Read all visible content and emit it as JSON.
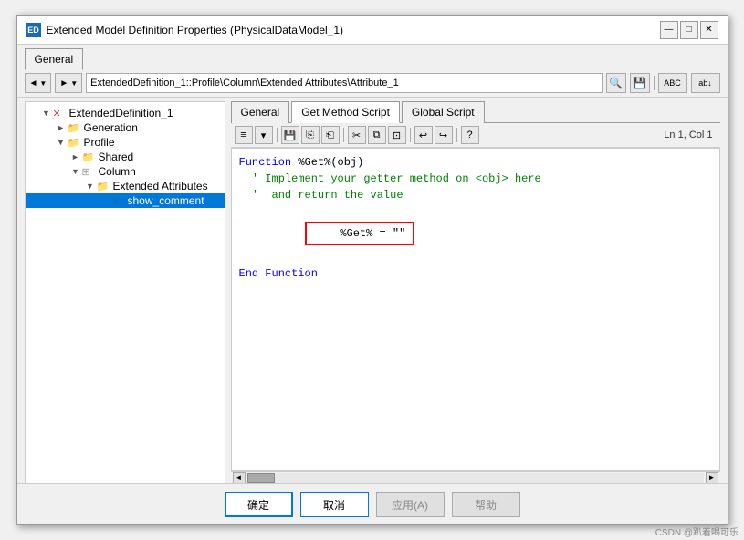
{
  "dialog": {
    "title": "Extended Model Definition Properties (PhysicalDataModel_1)",
    "title_icon": "ED"
  },
  "title_buttons": {
    "minimize": "—",
    "maximize": "□",
    "close": "✕"
  },
  "outer_tab": {
    "label": "General"
  },
  "toolbar": {
    "back_label": "◄",
    "forward_label": "►",
    "path_value": "ExtendedDefinition_1::Profile\\Column\\Extended Attributes\\Attribute_1",
    "search_icon": "🔍",
    "save_icon": "💾",
    "abc_icon": "ABC",
    "ab_icon": "ab↓"
  },
  "tree": {
    "items": [
      {
        "id": "extended-def",
        "label": "ExtendedDefinition_1",
        "indent": 0,
        "type": "root",
        "expanded": true
      },
      {
        "id": "generation",
        "label": "Generation",
        "indent": 1,
        "type": "folder",
        "expanded": false
      },
      {
        "id": "profile",
        "label": "Profile",
        "indent": 1,
        "type": "folder",
        "expanded": true
      },
      {
        "id": "shared",
        "label": "Shared",
        "indent": 2,
        "type": "folder",
        "expanded": false
      },
      {
        "id": "column",
        "label": "Column",
        "indent": 2,
        "type": "folder",
        "expanded": true
      },
      {
        "id": "extended-attrs",
        "label": "Extended Attributes",
        "indent": 3,
        "type": "folder",
        "expanded": true
      },
      {
        "id": "show-comment",
        "label": "show_comment",
        "indent": 4,
        "type": "item",
        "selected": true
      }
    ]
  },
  "inner_tabs": [
    {
      "id": "general-tab",
      "label": "General",
      "active": false
    },
    {
      "id": "get-method-tab",
      "label": "Get Method Script",
      "active": true
    },
    {
      "id": "global-script-tab",
      "label": "Global Script",
      "active": false
    }
  ],
  "inner_toolbar": {
    "btn1": "≡",
    "btn2": "▾",
    "btn3": "💾",
    "btn4": "⎘",
    "btn5": "⎗",
    "btn6": "✂",
    "btn7": "⧉",
    "btn8": "⊡",
    "btn9": "↩",
    "btn10": "↪",
    "btn11": "?",
    "ln_col": "Ln 1, Col 1"
  },
  "code": {
    "line1": "Function %Get%(obj)",
    "line2": "  ' Implement your getter method on <obj> here",
    "line3": "  ' and return the value",
    "line4": "    %Get% = \"\"",
    "line5": "End Function"
  },
  "bottom_buttons": {
    "ok": "确定",
    "cancel": "取消",
    "apply": "应用(A)",
    "help": "帮助"
  },
  "watermark": "CSDN @趴着喝可乐"
}
